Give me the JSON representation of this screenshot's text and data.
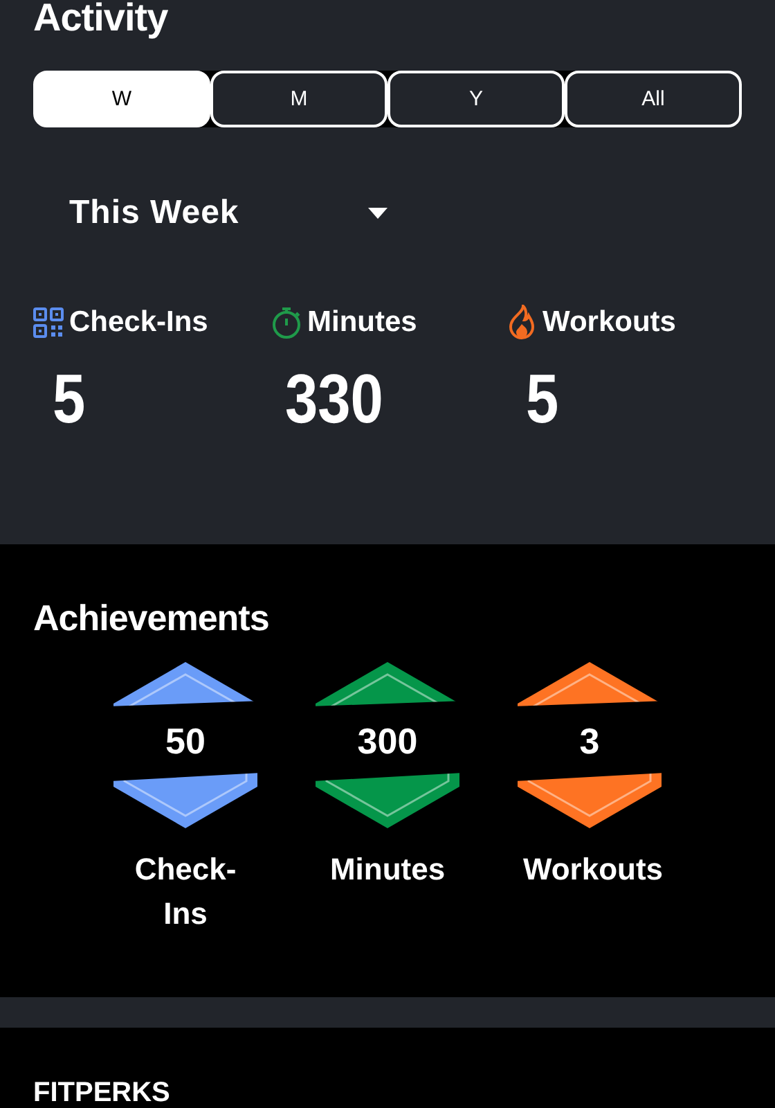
{
  "title": "Activity",
  "segments": [
    {
      "label": "W",
      "selected": true
    },
    {
      "label": "M",
      "selected": false
    },
    {
      "label": "Y",
      "selected": false
    },
    {
      "label": "All",
      "selected": false
    }
  ],
  "period": {
    "value": "This Week"
  },
  "stats": [
    {
      "kind": "checkins",
      "label": "Check-Ins",
      "value": "5",
      "color": "#5b8def"
    },
    {
      "kind": "minutes",
      "label": "Minutes",
      "value": "330",
      "color": "#1f9a4a"
    },
    {
      "kind": "workouts",
      "label": "Workouts",
      "value": "5",
      "color": "#f26b21"
    }
  ],
  "achievements": {
    "title": "Achievements",
    "badges": [
      {
        "value": "50",
        "label": "Check-Ins",
        "color": "#6a9cf8"
      },
      {
        "value": "300",
        "label": "Minutes",
        "color": "#05964a"
      },
      {
        "value": "3",
        "label": "Workouts",
        "color": "#fe7323"
      }
    ]
  },
  "next_section": {
    "title": "FITPERKS"
  }
}
